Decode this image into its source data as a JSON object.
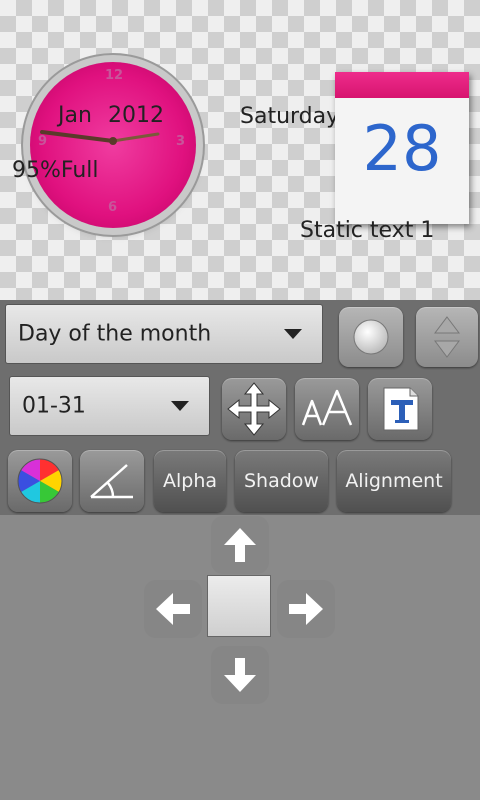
{
  "preview": {
    "clock": {
      "numerals": [
        "12",
        "3",
        "6",
        "9"
      ],
      "month": "Jan",
      "year": "2012",
      "accent_color": "#e0117f"
    },
    "battery_text": "95%Full",
    "weekday_text": "Saturday",
    "calendar": {
      "day": "28",
      "header_color": "#e0207f",
      "day_color": "#2d66cc"
    },
    "static_text": "Static text 1"
  },
  "controls": {
    "field_dropdown": {
      "selected": "Day of the month"
    },
    "format_dropdown": {
      "selected": "01-31"
    },
    "buttons": {
      "alpha": "Alpha",
      "shadow": "Shadow",
      "alignment": "Alignment"
    },
    "icons": {
      "record": "circle-icon",
      "stepper": "up-down-arrows-icon",
      "move": "move-arrows-icon",
      "font_size": "font-size-icon",
      "font": "font-t-icon",
      "color": "color-wheel-icon",
      "angle": "angle-icon"
    }
  },
  "arrow_pad": {
    "icons": [
      "arrow-up-icon",
      "arrow-left-icon",
      "arrow-right-icon",
      "arrow-down-icon"
    ]
  }
}
